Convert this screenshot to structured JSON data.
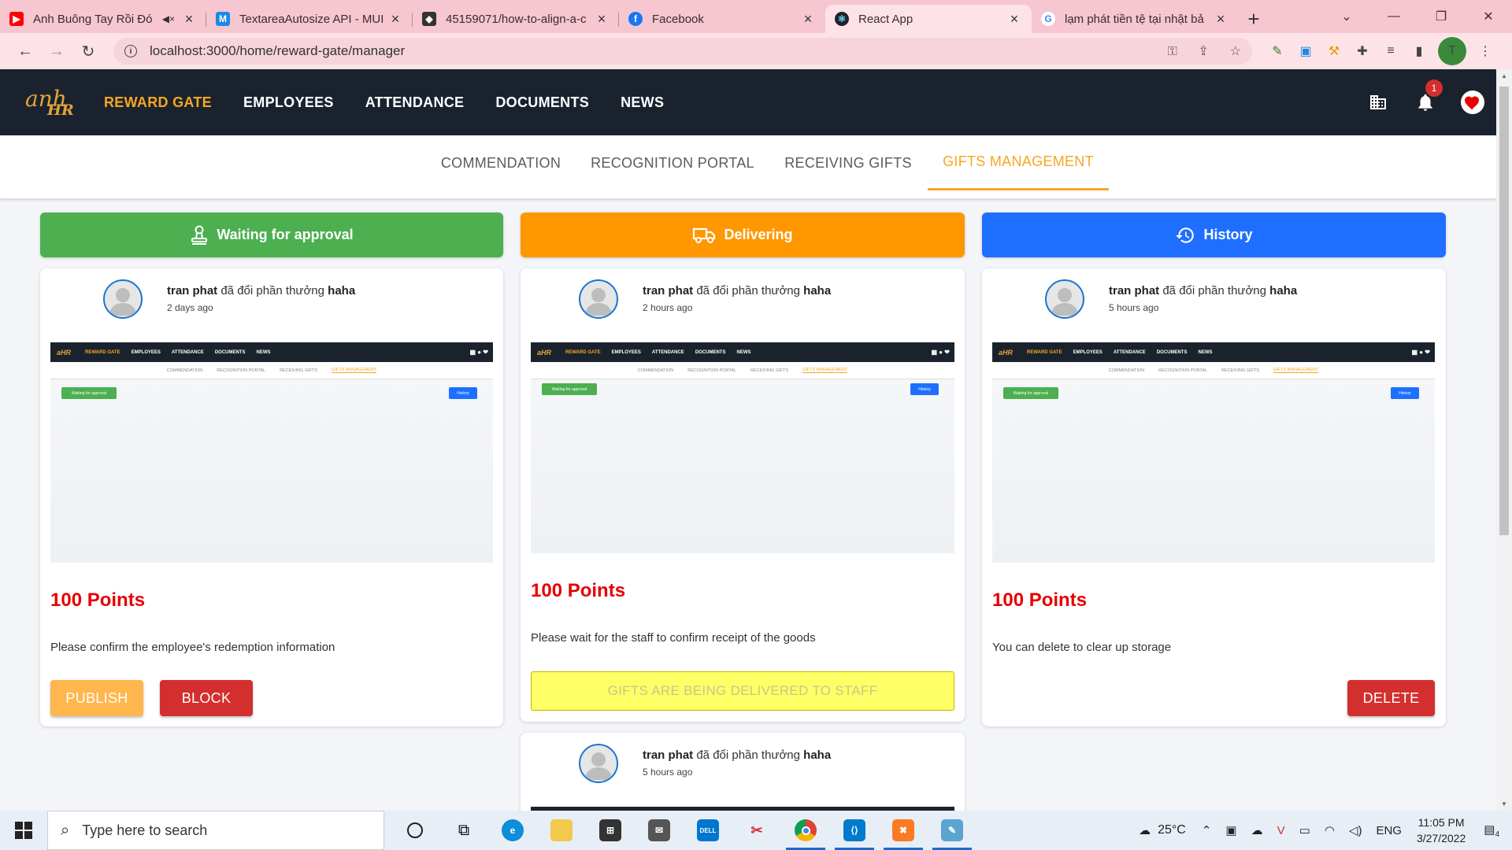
{
  "browser": {
    "tabs": [
      {
        "title": "Anh Buông Tay Rồi Đó",
        "icon": "youtube-icon",
        "color": "#ff0000",
        "sound": true
      },
      {
        "title": "TextareaAutosize API - MUI",
        "icon": "mui-icon",
        "color": "#1e88e5"
      },
      {
        "title": "45159071/how-to-align-a-c",
        "icon": "codesandbox-icon",
        "color": "#333333"
      },
      {
        "title": "Facebook",
        "icon": "facebook-icon",
        "color": "#1877f2"
      },
      {
        "title": "React App",
        "icon": "react-icon",
        "color": "#20232a",
        "active": true
      },
      {
        "title": "lạm phát tiền tệ tại nhật bả",
        "icon": "google-icon",
        "color": "#4285f4"
      }
    ],
    "url": "localhost:3000/home/reward-gate/manager",
    "profile_initial": "T"
  },
  "app": {
    "logo_text_1": "anh",
    "logo_text_2": "HR",
    "nav": [
      {
        "label": "REWARD GATE",
        "active": true
      },
      {
        "label": "EMPLOYEES"
      },
      {
        "label": "ATTENDANCE"
      },
      {
        "label": "DOCUMENTS"
      },
      {
        "label": "NEWS"
      }
    ],
    "notification_count": "1",
    "accent_color": "#f5a623"
  },
  "subtabs": [
    {
      "label": "COMMENDATION"
    },
    {
      "label": "RECOGNITION PORTAL"
    },
    {
      "label": "RECEIVING GIFTS"
    },
    {
      "label": "GIFTS MANAGEMENT",
      "active": true
    }
  ],
  "columns": {
    "waiting": {
      "title": "Waiting for approval",
      "color": "#4caf50"
    },
    "delivering": {
      "title": "Delivering",
      "color": "#ff9800"
    },
    "history": {
      "title": "History",
      "color": "#1e6fff"
    }
  },
  "cards": {
    "waiting": {
      "user": "tran phat",
      "action": " đã đổi phần thưởng ",
      "reward": "haha",
      "time": "2 days ago",
      "points": "100 Points",
      "desc": "Please confirm the employee's redemption information",
      "publish_label": "PUBLISH",
      "block_label": "BLOCK"
    },
    "delivering": {
      "user": "tran phat",
      "action": " đã đổi phần thưởng ",
      "reward": "haha",
      "time": "2 hours ago",
      "points": "100 Points",
      "desc": "Please wait for the staff to confirm receipt of the goods",
      "status_label": "GIFTS ARE BEING DELIVERED TO STAFF"
    },
    "delivering2": {
      "user": "tran phat",
      "action": " đã đổi phần thưởng ",
      "reward": "haha",
      "time": "5 hours ago"
    },
    "history": {
      "user": "tran phat",
      "action": " đã đổi phần thưởng ",
      "reward": "haha",
      "time": "5 hours ago",
      "points": "100 Points",
      "desc": "You can delete to clear up storage",
      "delete_label": "DELETE"
    }
  },
  "preview": {
    "nav": [
      "REWARD GATE",
      "EMPLOYEES",
      "ATTENDANCE",
      "DOCUMENTS",
      "NEWS"
    ],
    "subtabs": [
      "COMMENDATION",
      "RECOGNITION PORTAL",
      "RECEIVING GIFTS",
      "GIFTS MANAGEMENT"
    ],
    "green_label": "Waiting for approval",
    "blue_label": "History"
  },
  "taskbar": {
    "search_placeholder": "Type here to search",
    "weather": "25°C",
    "language": "ENG",
    "time": "11:05 PM",
    "date": "3/27/2022",
    "notif_count": "4"
  }
}
